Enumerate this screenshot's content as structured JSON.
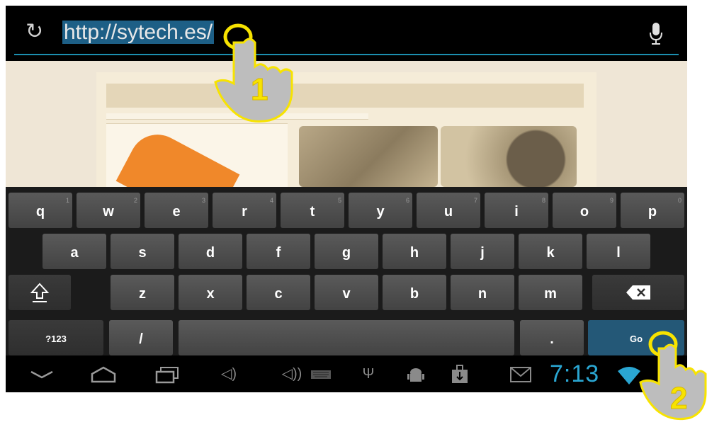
{
  "address_bar": {
    "refresh_icon": "refresh-icon",
    "url": "http://sytech.es/",
    "mic_icon": "microphone-icon",
    "accent": "#1c8fb0",
    "selection_color": "#1d5f86"
  },
  "keyboard": {
    "row1": [
      {
        "label": "q",
        "hint": "1"
      },
      {
        "label": "w",
        "hint": "2"
      },
      {
        "label": "e",
        "hint": "3"
      },
      {
        "label": "r",
        "hint": "4"
      },
      {
        "label": "t",
        "hint": "5"
      },
      {
        "label": "y",
        "hint": "6"
      },
      {
        "label": "u",
        "hint": "7"
      },
      {
        "label": "i",
        "hint": "8"
      },
      {
        "label": "o",
        "hint": "9"
      },
      {
        "label": "p",
        "hint": "0"
      }
    ],
    "row2": [
      "a",
      "s",
      "d",
      "f",
      "g",
      "h",
      "j",
      "k",
      "l"
    ],
    "row3": [
      "z",
      "x",
      "c",
      "v",
      "b",
      "n",
      "m"
    ],
    "shift_icon": "shift-arrow-icon",
    "delete_icon": "backspace-icon",
    "symbols_label": "?123",
    "slash_label": "/",
    "period_label": ".",
    "go_label": "Go",
    "go_color": "#245877"
  },
  "navbar": {
    "icons": [
      "hide-keyboard-icon",
      "home-icon",
      "recent-apps-icon",
      "volume-down-icon",
      "volume-up-icon",
      "keyboard-icon",
      "usb-icon",
      "android-debug-icon",
      "download-icon",
      "gmail-icon",
      "wifi-icon"
    ],
    "time": "7:13",
    "clock_color": "#2aa6d2"
  },
  "annotations": {
    "step1": "1",
    "step2": "2",
    "marker_color": "#f7e300"
  }
}
